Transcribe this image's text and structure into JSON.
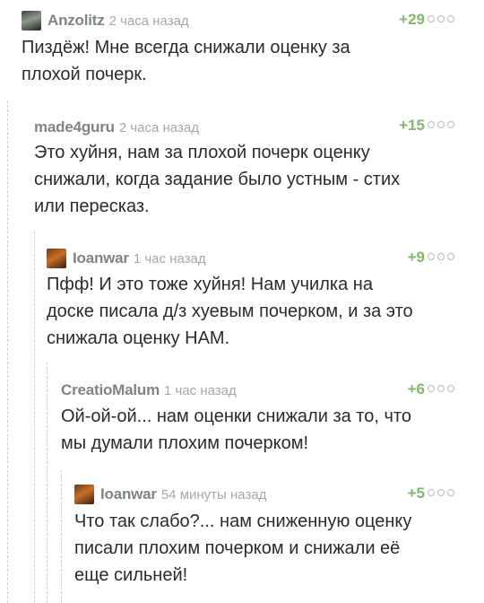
{
  "colors": {
    "accent_rating": "#81b867",
    "author": "#7d877e",
    "time": "#a4aaa3",
    "thread_line": "#c9cfc6"
  },
  "comments": [
    {
      "author": "Anzolitz",
      "time": "2 часа назад",
      "rating": "+29",
      "avatar": "user-avatar",
      "text": "Пиздёж! Мне всегда снижали оценку за\nплохой почерк."
    },
    {
      "author": "made4guru",
      "time": "2 часа назад",
      "rating": "+15",
      "text": "Это хуйня, нам за плохой почерк оценку\nснижали, когда задание было устным - стих\nили пересказ."
    },
    {
      "author": "Ioanwar",
      "time": "1 час назад",
      "rating": "+9",
      "avatar": "user-avatar",
      "text": "Пфф! И это тоже хуйня! Нам училка на\nдоске писала д/з хуевым почерком, и за это\nснижала оценку НАМ."
    },
    {
      "author": "CreatioMalum",
      "time": "1 час назад",
      "rating": "+6",
      "text": "Ой-ой-ой... нам оценки снижали за то, что\nмы думали плохим почерком!"
    },
    {
      "author": "Ioanwar",
      "time": "54 минуты назад",
      "rating": "+5",
      "avatar": "user-avatar",
      "text": "Что так слабо?... нам сниженную оценку\nписали плохим почерком и снижали её\nеще сильней!"
    }
  ]
}
